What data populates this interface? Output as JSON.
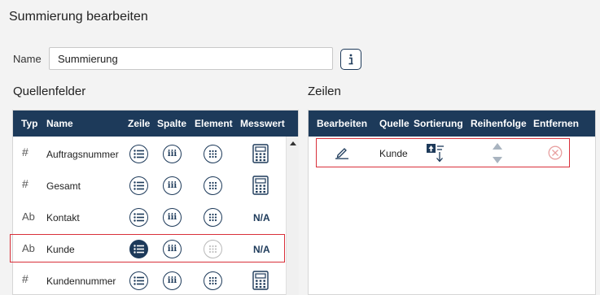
{
  "dialog": {
    "title": "Summierung bearbeiten"
  },
  "name_field": {
    "label": "Name",
    "value": "Summierung"
  },
  "source": {
    "title": "Quellenfelder",
    "columns": {
      "typ": "Typ",
      "name": "Name",
      "zeile": "Zeile",
      "spalte": "Spalte",
      "element": "Element",
      "messwert": "Messwert"
    },
    "rows": [
      {
        "type_symbol": "#",
        "name": "Auftragsnummer",
        "messwert": "calculator-icon"
      },
      {
        "type_symbol": "#",
        "name": "Gesamt",
        "messwert": "calculator-icon"
      },
      {
        "type_symbol": "Ab",
        "name": "Kontakt",
        "messwert_text": "N/A"
      },
      {
        "type_symbol": "Ab",
        "name": "Kunde",
        "messwert_text": "N/A",
        "selected": true
      },
      {
        "type_symbol": "#",
        "name": "Kundennummer",
        "messwert": "calculator-icon"
      }
    ]
  },
  "rows_section": {
    "title": "Zeilen",
    "columns": {
      "bearbeiten": "Bearbeiten",
      "quelle": "Quelle",
      "sortierung": "Sortierung",
      "reihenfolge": "Reihenfolge",
      "entfernen": "Entfernen"
    },
    "items": [
      {
        "name": "Kunde"
      }
    ]
  },
  "colors": {
    "header_bg": "#1d3a5a",
    "highlight": "#d9303a",
    "remove_icon": "#e8a0a0"
  }
}
